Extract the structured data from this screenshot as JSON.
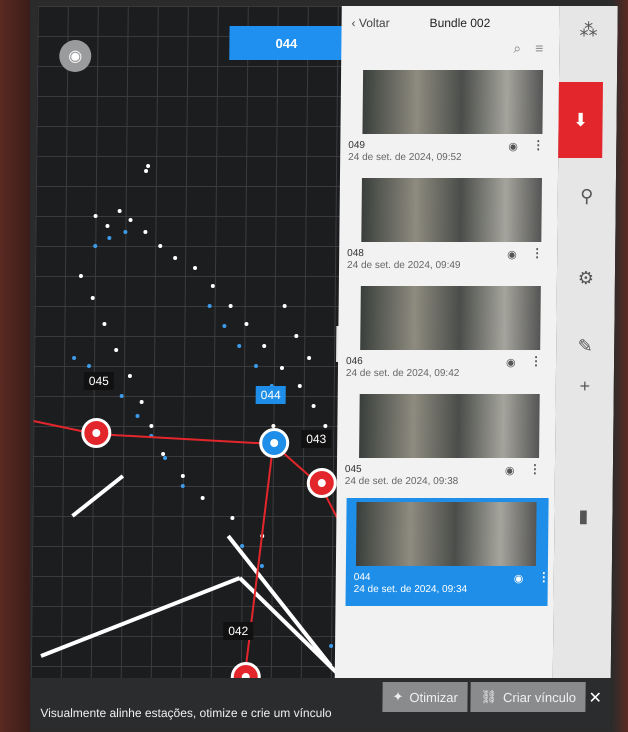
{
  "map": {
    "top_tag": "044",
    "stations": [
      {
        "id": "045",
        "label": "045"
      },
      {
        "id": "044",
        "label": "044"
      },
      {
        "id": "043",
        "label": "043"
      },
      {
        "id": "042",
        "label": "042"
      }
    ]
  },
  "panel": {
    "back_label": "Voltar",
    "title": "Bundle 002",
    "items": [
      {
        "name": "049",
        "date": "24 de set. de 2024, 09:52"
      },
      {
        "name": "048",
        "date": "24 de set. de 2024, 09:49"
      },
      {
        "name": "046",
        "date": "24 de set. de 2024, 09:42"
      },
      {
        "name": "045",
        "date": "24 de set. de 2024, 09:38"
      },
      {
        "name": "044",
        "date": "24 de set. de 2024, 09:34"
      }
    ]
  },
  "bottom": {
    "hint": "Visualmente alinhe estações, otimize e crie um vínculo",
    "optimize_label": "Otimizar",
    "link_label": "Criar vínculo"
  }
}
